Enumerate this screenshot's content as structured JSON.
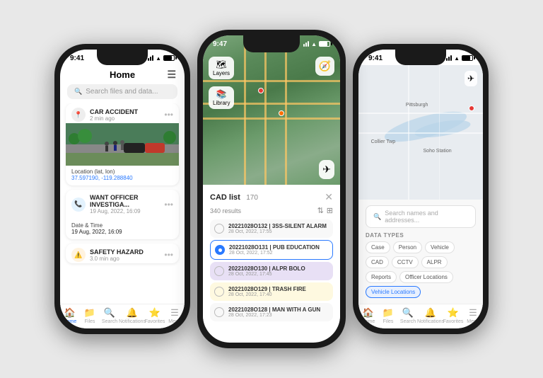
{
  "phones": {
    "left": {
      "status_time": "9:41",
      "title": "Home",
      "search_placeholder": "Search files and data...",
      "cards": [
        {
          "icon": "📍",
          "title": "CAR ACCIDENT",
          "time": "2 min ago",
          "has_image": true,
          "location_label": "Location (lat, lon)",
          "coords": "37.597190, -119.288840"
        },
        {
          "icon": "📞",
          "title": "WANT OFFICER INVESTIGA...",
          "time": "19 Aug, 2022, 16:09",
          "date_label": "Date & Time",
          "date_value": "19 Aug, 2022, 16:09"
        },
        {
          "icon": "⚠️",
          "title": "SAFETY HAZARD",
          "time": "3.0 min ago"
        }
      ],
      "nav": [
        {
          "label": "Home",
          "icon": "🏠",
          "active": true
        },
        {
          "label": "Files",
          "icon": "📁",
          "active": false
        },
        {
          "label": "Search",
          "icon": "🔍",
          "active": false
        },
        {
          "label": "Notifications",
          "icon": "🔔",
          "active": false
        },
        {
          "label": "Favorites",
          "icon": "⭐",
          "active": false
        },
        {
          "label": "Menu",
          "icon": "☰",
          "active": false
        }
      ]
    },
    "center": {
      "status_time": "9:47",
      "cad_title": "CAD list",
      "cad_count": "170",
      "cad_results": "340 results",
      "items": [
        {
          "id": "20221028O132",
          "separator": "3SS-SILENT ALARM",
          "date": "28 Oct, 2022, 17:55",
          "highlight": "none",
          "checked": false
        },
        {
          "id": "20221028O131",
          "separator": "PUB EDUCATION",
          "date": "28 Oct, 2022, 17:52",
          "highlight": "none",
          "checked": true
        },
        {
          "id": "20221028O130",
          "separator": "ALPR BOLO",
          "date": "28 Oct, 2022, 17:45",
          "highlight": "purple",
          "checked": false
        },
        {
          "id": "20221028O129",
          "separator": "TRASH FIRE",
          "date": "28 Oct, 2022, 17:40",
          "highlight": "yellow",
          "checked": false
        },
        {
          "id": "20221028O128",
          "separator": "MAN WITH A GUN",
          "date": "28 Oct, 2022, 17:23",
          "highlight": "none",
          "checked": false
        }
      ],
      "map_buttons": [
        {
          "label": "Layers",
          "icon": "🗺"
        },
        {
          "label": "Library",
          "icon": "📚"
        }
      ]
    },
    "right": {
      "status_time": "9:41",
      "search_placeholder": "Search names and addresses...",
      "data_types_label": "DATA TYPES",
      "chips": [
        {
          "label": "Case",
          "active": false
        },
        {
          "label": "Person",
          "active": false
        },
        {
          "label": "Vehicle",
          "active": false
        },
        {
          "label": "CAD",
          "active": false
        },
        {
          "label": "CCTV",
          "active": false
        },
        {
          "label": "ALPR",
          "active": false
        },
        {
          "label": "Reports",
          "active": false
        },
        {
          "label": "Officer Locations",
          "active": false
        },
        {
          "label": "Vehicle Locations",
          "active": true
        }
      ],
      "map_labels": [
        "Pittsburgh",
        "Collier Twp",
        "Soho Station"
      ],
      "nav": [
        {
          "label": "Home",
          "icon": "🏠",
          "active": false
        },
        {
          "label": "Files",
          "icon": "📁",
          "active": false
        },
        {
          "label": "Search",
          "icon": "🔍",
          "active": false
        },
        {
          "label": "Notifications",
          "icon": "🔔",
          "active": false
        },
        {
          "label": "Favorites",
          "icon": "⭐",
          "active": false
        },
        {
          "label": "Menu",
          "icon": "☰",
          "active": false
        }
      ]
    }
  }
}
